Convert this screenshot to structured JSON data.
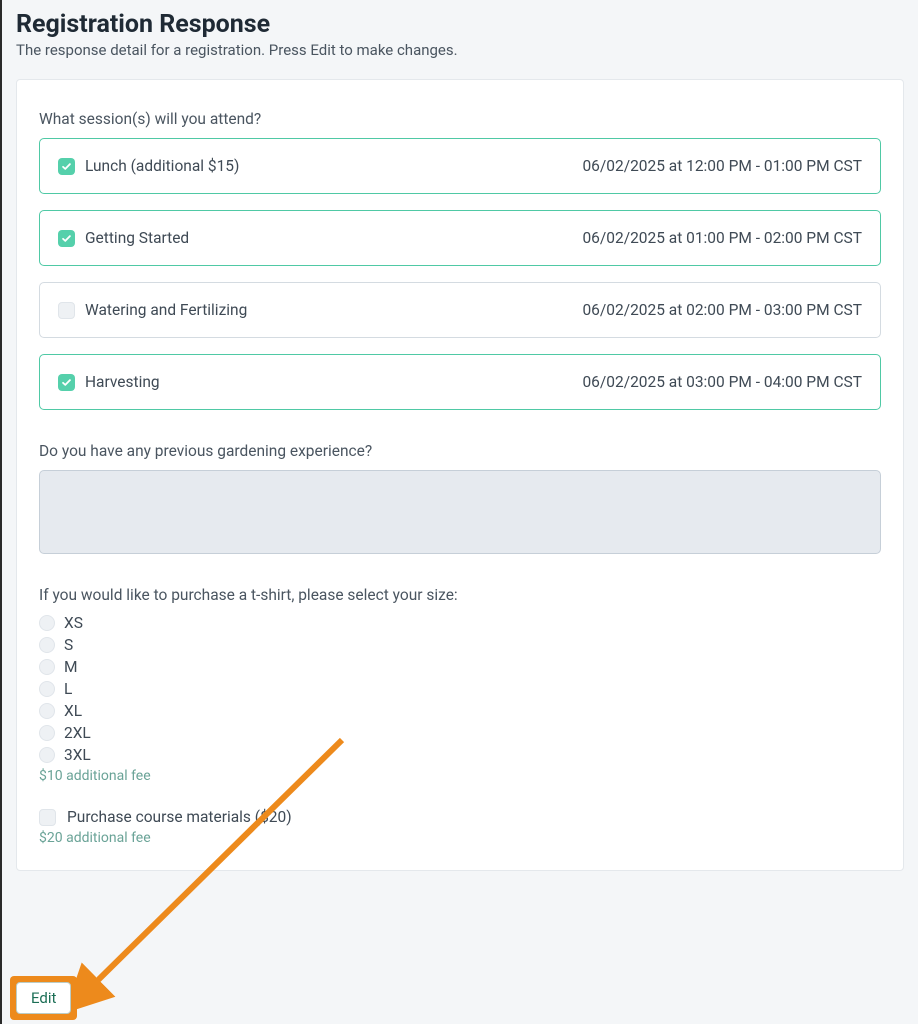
{
  "header": {
    "title": "Registration Response",
    "subtitle": "The response detail for a registration. Press Edit to make changes."
  },
  "q_sessions": {
    "label": "What session(s) will you attend?",
    "items": [
      {
        "title": "Lunch (additional $15)",
        "time": "06/02/2025 at 12:00 PM - 01:00 PM CST",
        "checked": true
      },
      {
        "title": "Getting Started",
        "time": "06/02/2025 at 01:00 PM - 02:00 PM CST",
        "checked": true
      },
      {
        "title": "Watering and Fertilizing",
        "time": "06/02/2025 at 02:00 PM - 03:00 PM CST",
        "checked": false
      },
      {
        "title": "Harvesting",
        "time": "06/02/2025 at 03:00 PM - 04:00 PM CST",
        "checked": true
      }
    ]
  },
  "q_experience": {
    "label": "Do you have any previous gardening experience?",
    "value": ""
  },
  "q_tshirt": {
    "label": "If you would like to purchase a t-shirt, please select your size:",
    "options": [
      "XS",
      "S",
      "M",
      "L",
      "XL",
      "2XL",
      "3XL"
    ],
    "fee_note": "$10 additional fee"
  },
  "q_materials": {
    "label": "Purchase course materials ($20)",
    "checked": false,
    "fee_note": "$20 additional fee"
  },
  "actions": {
    "edit_label": "Edit"
  },
  "colors": {
    "accent_teal": "#55d0ab",
    "annotation_orange": "#ed8a1c"
  }
}
